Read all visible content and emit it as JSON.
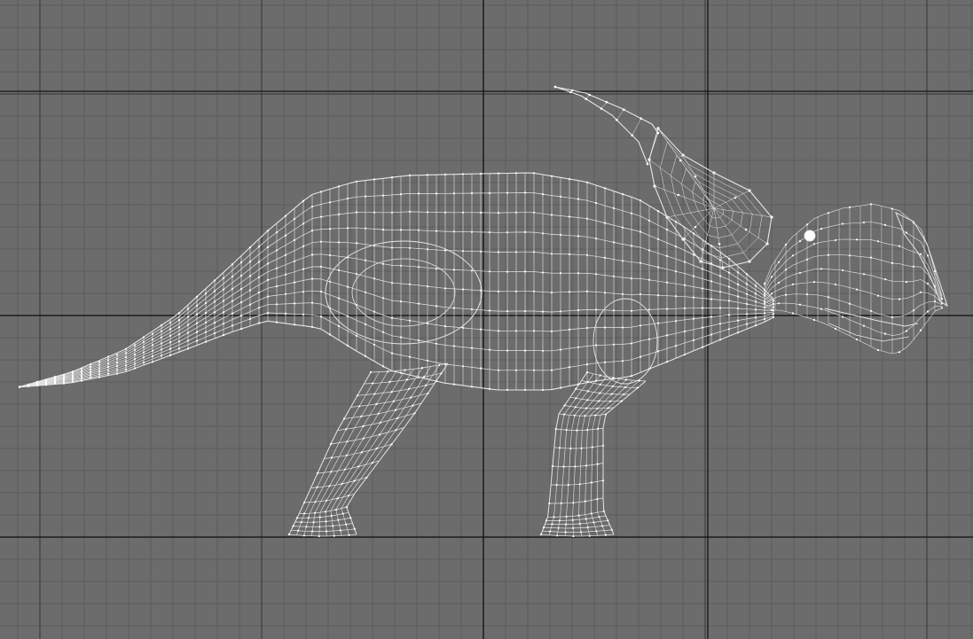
{
  "viewport": {
    "view_name": "side-orthographic",
    "display_mode": "wireframe",
    "colors": {
      "background": "#6c6c6c",
      "grid_minor": "#5b5b5b",
      "grid_major": "#3e3e3e",
      "axis": "#141414",
      "wire": "#e6e6e6",
      "vertex": "#ffffff"
    }
  },
  "model": {
    "subject": "ceratopsian-dinosaur",
    "icon": "wireframe-mesh-icon"
  }
}
